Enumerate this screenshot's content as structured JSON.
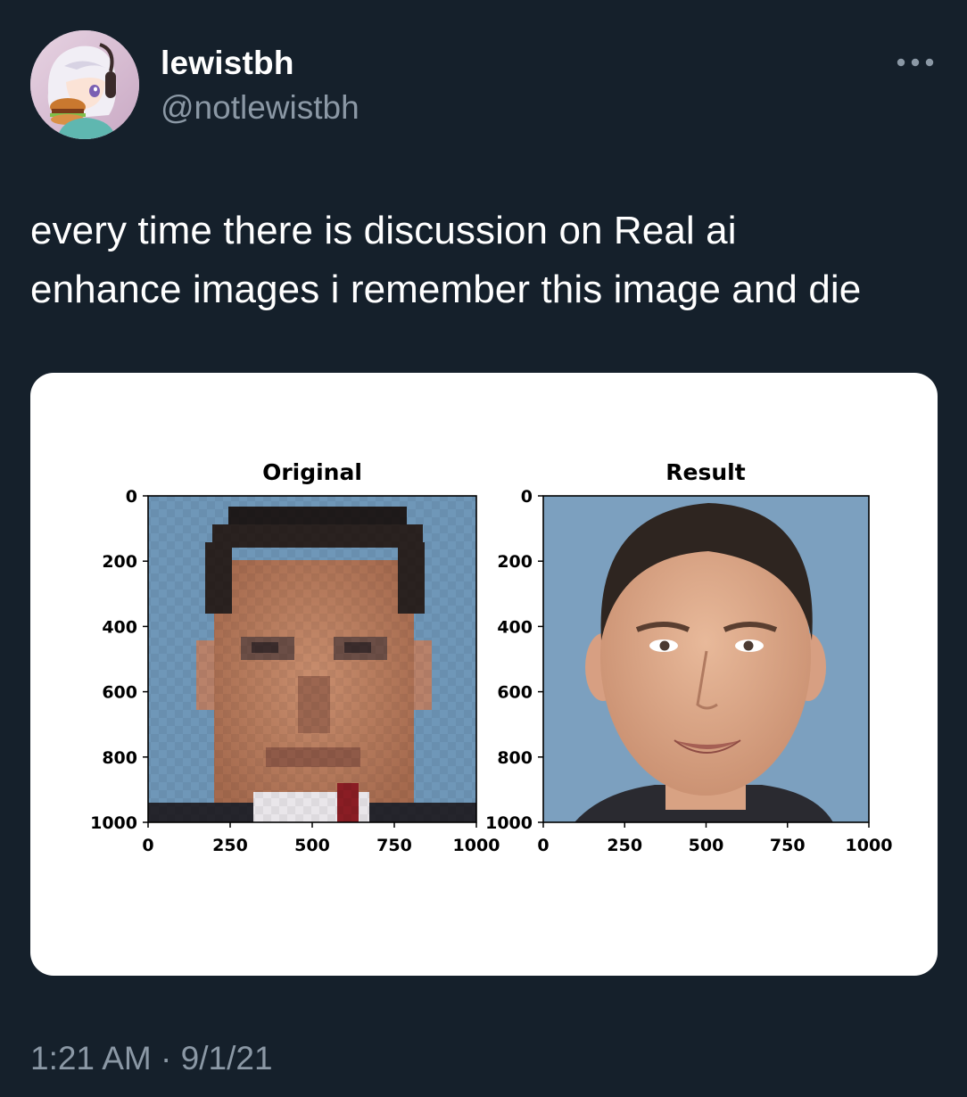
{
  "author": {
    "display_name": "lewistbh",
    "handle": "@notlewistbh",
    "avatar_icon": "anime-avatar-icon"
  },
  "tweet": {
    "text_line1": "every time there is discussion on Real ai",
    "text_line2": "enhance images i remember this image and die",
    "time": "1:21 AM",
    "separator": "·",
    "date": "9/1/21"
  },
  "more_icon": "more-horizontal-icon",
  "colors": {
    "background": "#15202b",
    "text": "#ffffff",
    "secondary_text": "#8b98a5",
    "card": "#ffffff",
    "photo_bg": "#6f97b8"
  },
  "chart_data": [
    {
      "type": "image-plot",
      "title": "Original",
      "y_ticks": [
        "0",
        "200",
        "400",
        "600",
        "800",
        "1000"
      ],
      "x_ticks": [
        "0",
        "250",
        "500",
        "750",
        "1000"
      ],
      "xlim": [
        0,
        1000
      ],
      "ylim": [
        0,
        1000
      ],
      "y_inverted": true,
      "content": "pixelated face"
    },
    {
      "type": "image-plot",
      "title": "Result",
      "y_ticks": [
        "0",
        "200",
        "400",
        "600",
        "800",
        "1000"
      ],
      "x_ticks": [
        "0",
        "250",
        "500",
        "750",
        "1000"
      ],
      "xlim": [
        0,
        1000
      ],
      "ylim": [
        0,
        1000
      ],
      "y_inverted": true,
      "content": "upscaled face"
    }
  ]
}
